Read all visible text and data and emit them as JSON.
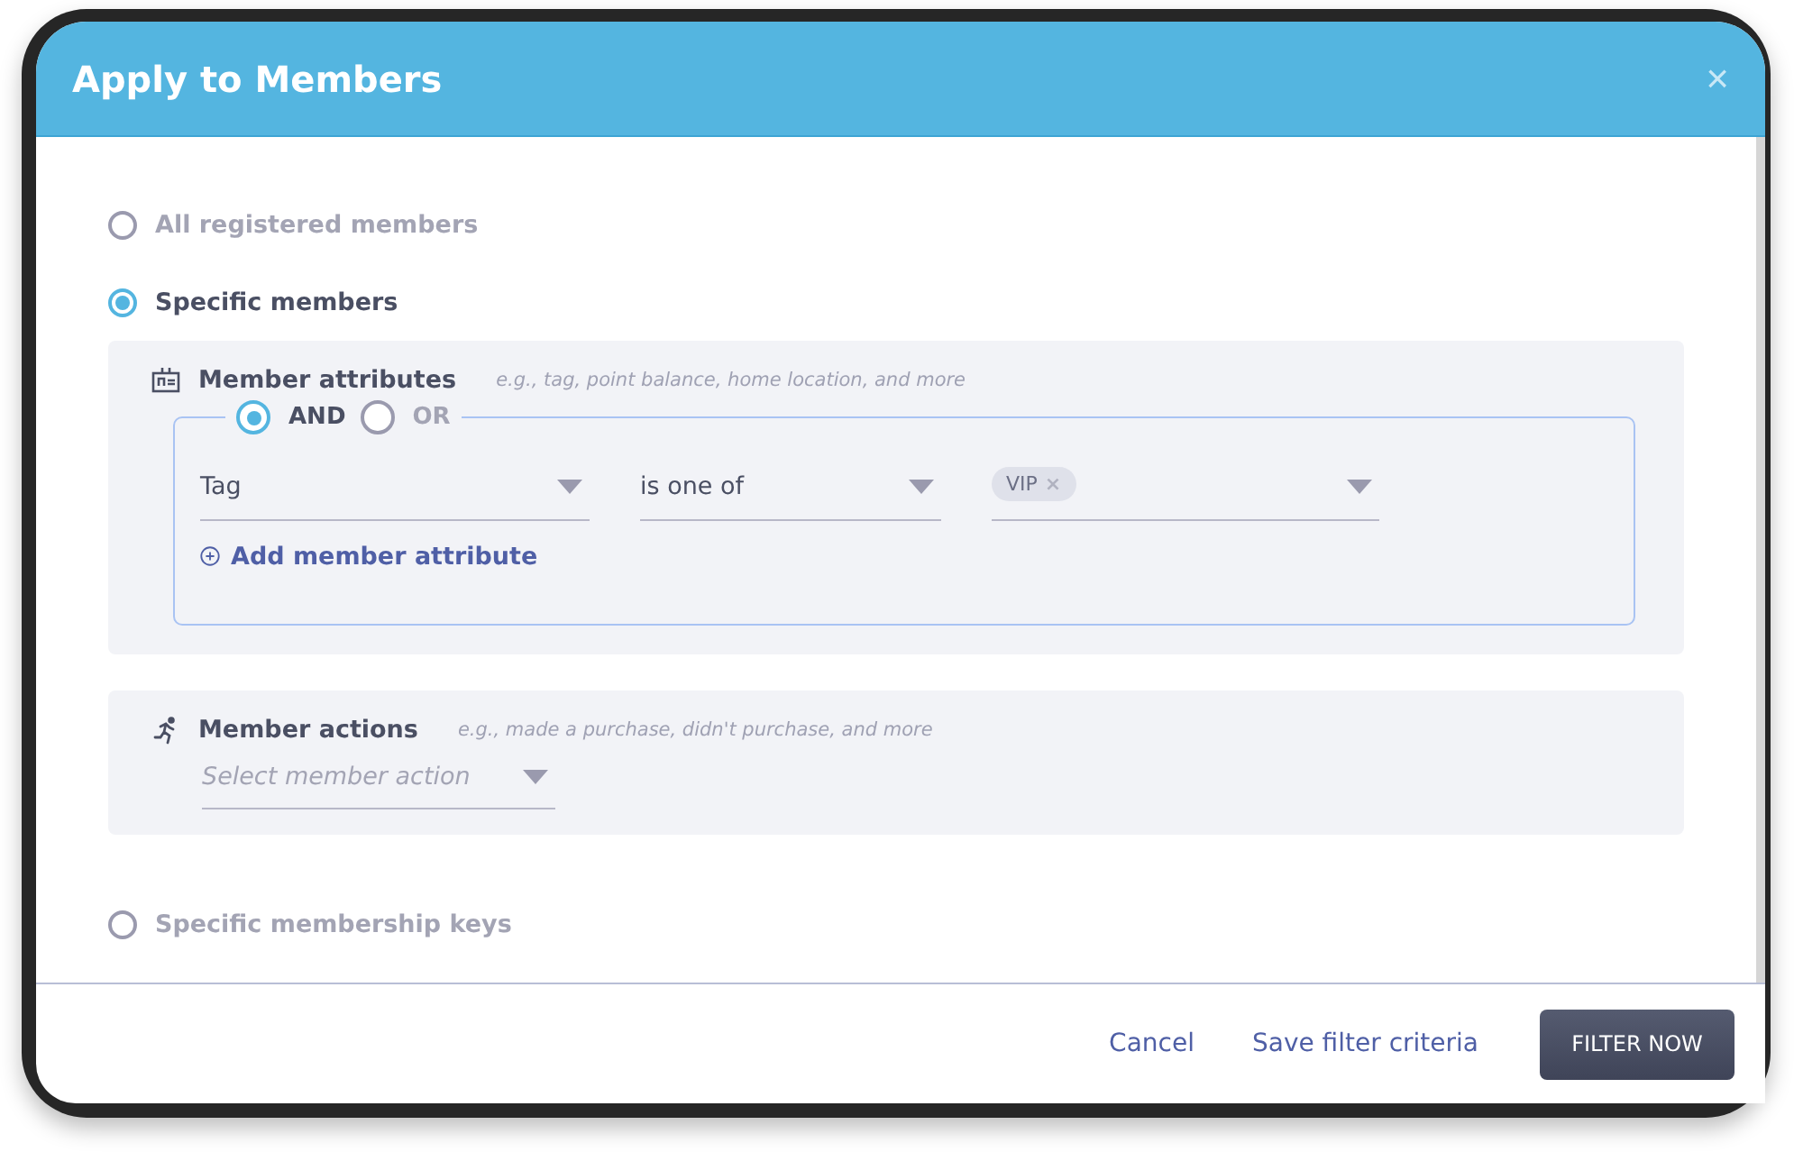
{
  "dialog": {
    "title": "Apply to Members",
    "close": "×"
  },
  "audience": [
    {
      "label": "All registered members",
      "selected": false
    },
    {
      "label": "Specific members",
      "selected": true
    }
  ],
  "attributes": {
    "title": "Member attributes",
    "hint": "e.g., tag, point balance, home location, and more",
    "logic": [
      {
        "label": "AND",
        "selected": true
      },
      {
        "label": "OR",
        "selected": false
      }
    ],
    "rule": {
      "field": "Tag",
      "operator": "is one of",
      "tags": [
        {
          "label": "VIP",
          "remove": "×"
        }
      ]
    },
    "add": "Add member attribute"
  },
  "actions": {
    "title": "Member actions",
    "hint": "e.g., made a purchase, didn't purchase, and more",
    "placeholder": "Select member action"
  },
  "more_options": [
    {
      "label": "Specific membership keys",
      "selected": false
    }
  ],
  "footer": {
    "cancel": "Cancel",
    "save": "Save filter criteria",
    "submit": "FILTER NOW"
  }
}
